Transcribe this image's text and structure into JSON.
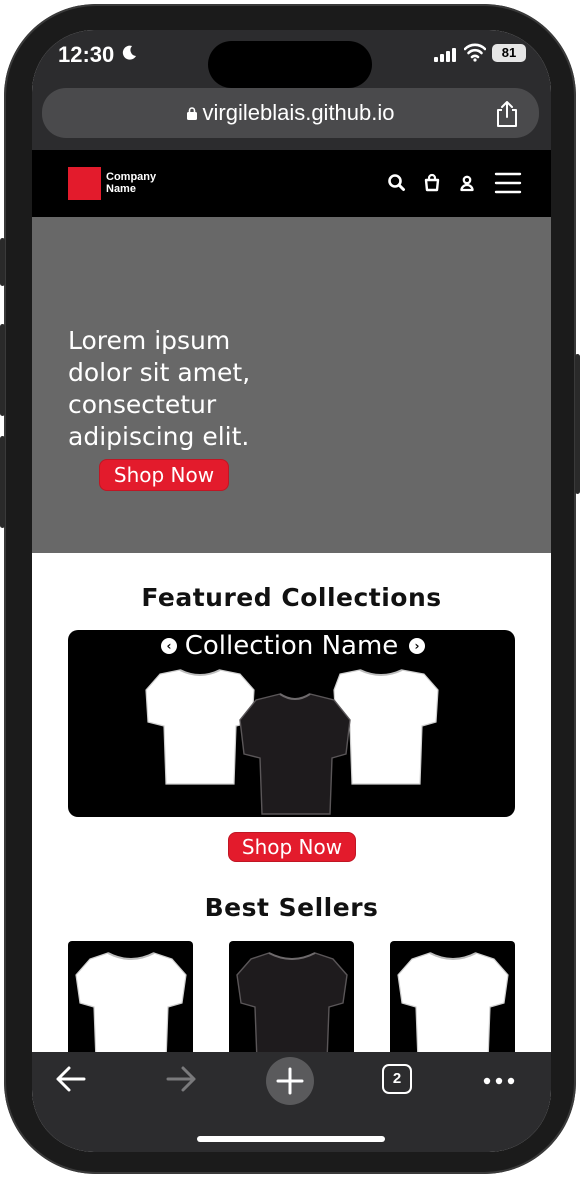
{
  "status_bar": {
    "time": "12:30",
    "battery": "81",
    "icons": [
      "moon-icon",
      "signal-icon",
      "wifi-icon",
      "battery-icon"
    ]
  },
  "browser": {
    "url": "virgileblais.github.io",
    "icons": [
      "lock-icon",
      "share-icon"
    ],
    "tab_count": "2",
    "bottom_icons": [
      "back-arrow-icon",
      "forward-arrow-icon",
      "new-tab-plus-icon",
      "tabs-icon",
      "more-dots-icon"
    ]
  },
  "site": {
    "logo": {
      "line1": "Company",
      "line2": "Name",
      "color": "#e31b2c"
    },
    "nav_icons": [
      "search-icon",
      "shopping-bag-icon",
      "user-icon",
      "menu-icon"
    ],
    "hero": {
      "text": "Lorem ipsum dolor sit amet, consectetur adipiscing elit.",
      "button": "Shop Now"
    },
    "featured": {
      "title": "Featured Collections",
      "collection_name": "Collection Name",
      "button": "Shop Now"
    },
    "best_sellers": {
      "title": "Best Sellers",
      "items": [
        {
          "tshirt": "white"
        },
        {
          "tshirt": "black"
        },
        {
          "tshirt": "white"
        }
      ]
    }
  },
  "colors": {
    "accent": "#e31b2c",
    "hero_bg": "#686868",
    "nav_bg": "#000000",
    "browser_chrome": "#2c2c2e"
  }
}
